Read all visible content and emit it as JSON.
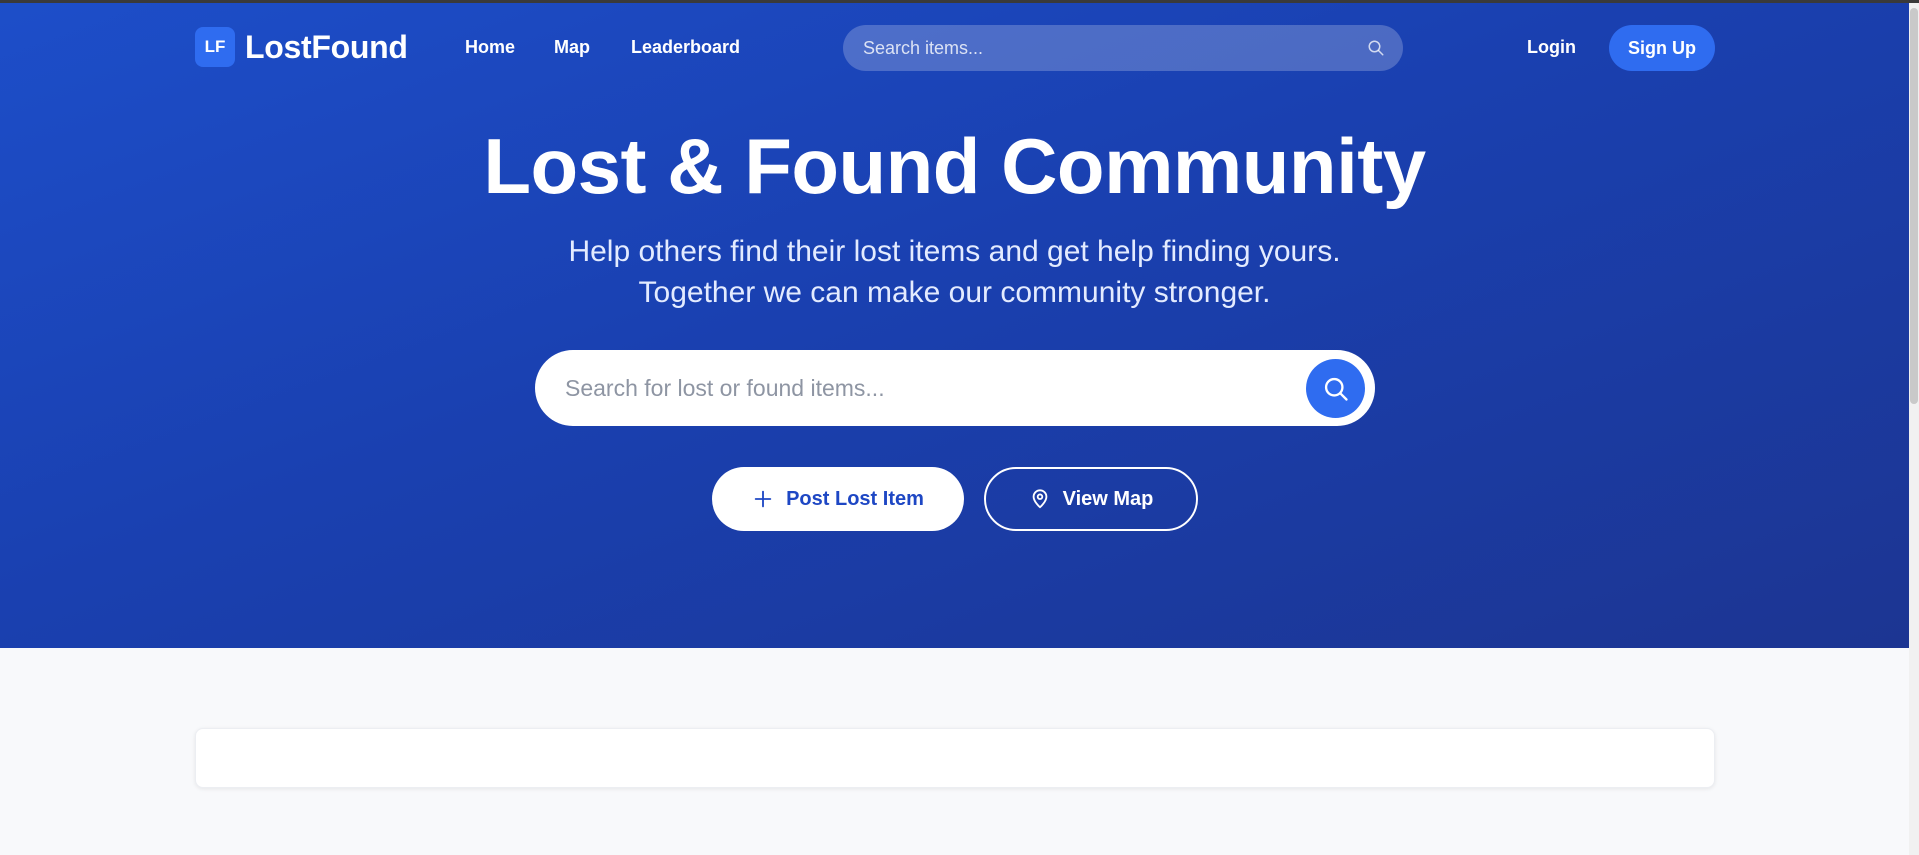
{
  "brand": {
    "badge": "LF",
    "name": "LostFound"
  },
  "nav": {
    "links": [
      "Home",
      "Map",
      "Leaderboard"
    ],
    "search_placeholder": "Search items...",
    "login_label": "Login",
    "signup_label": "Sign Up"
  },
  "hero": {
    "title": "Lost & Found Community",
    "subtitle_line1": "Help others find their lost items and get help finding yours.",
    "subtitle_line2": "Together we can make our community stronger.",
    "search_placeholder": "Search for lost or found items...",
    "post_button_label": "Post Lost Item",
    "map_button_label": "View Map"
  },
  "icons": {
    "nav_search": "search-icon",
    "hero_search": "search-icon",
    "post": "plus-icon",
    "map": "map-pin-icon"
  },
  "colors": {
    "hero_gradient_start": "#1d4ec9",
    "hero_gradient_end": "#1c3592",
    "accent": "#2f6cf0",
    "primary_button_text": "#1e47c4"
  }
}
